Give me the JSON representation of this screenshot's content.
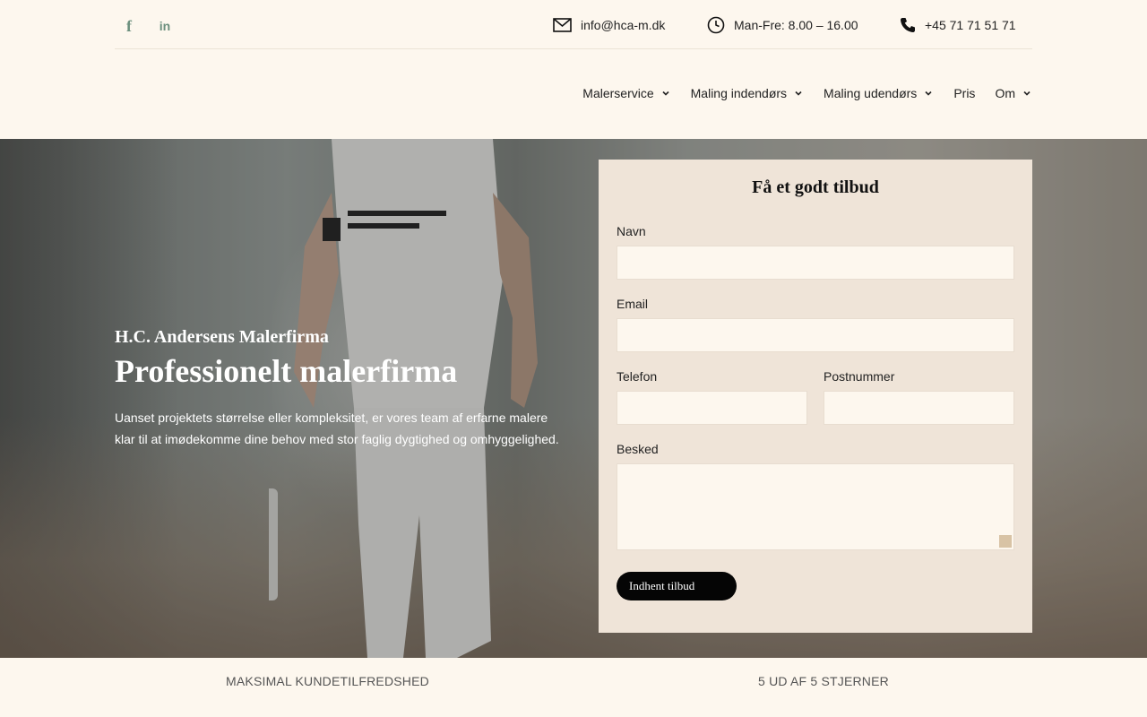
{
  "topbar": {
    "social": [
      {
        "name": "facebook",
        "glyph": "f"
      },
      {
        "name": "linkedin",
        "glyph": "in"
      }
    ],
    "email": "info@hca-m.dk",
    "hours": "Man-Fre: 8.00 – 16.00",
    "phone": "+45 71 71 51 71",
    "icon_color": "#6b8f7d"
  },
  "nav": {
    "items": [
      {
        "label": "Malerservice",
        "has_dropdown": true
      },
      {
        "label": "Maling indendørs",
        "has_dropdown": true
      },
      {
        "label": "Maling udendørs",
        "has_dropdown": true
      },
      {
        "label": "Pris",
        "has_dropdown": false
      },
      {
        "label": "Om",
        "has_dropdown": true
      }
    ]
  },
  "hero": {
    "subtitle": "H.C. Andersens Malerfirma",
    "title": "Professionelt malerfirma",
    "text": "Uanset projektets størrelse eller kompleksitet, er vores team af erfarne malere klar til at imødekomme dine behov med stor faglig dygtighed og omhyggelighed."
  },
  "form": {
    "title": "Få et godt tilbud",
    "fields": {
      "name": {
        "label": "Navn",
        "value": ""
      },
      "email": {
        "label": "Email",
        "value": ""
      },
      "phone": {
        "label": "Telefon",
        "value": ""
      },
      "zip": {
        "label": "Postnummer",
        "value": ""
      },
      "message": {
        "label": "Besked",
        "value": ""
      }
    },
    "submit_label": "Indhent tilbud",
    "bg_color": "#efe4d8"
  },
  "strip": {
    "left": "MAKSIMAL KUNDETILFREDSHED",
    "right": "5 UD AF 5 STJERNER"
  }
}
